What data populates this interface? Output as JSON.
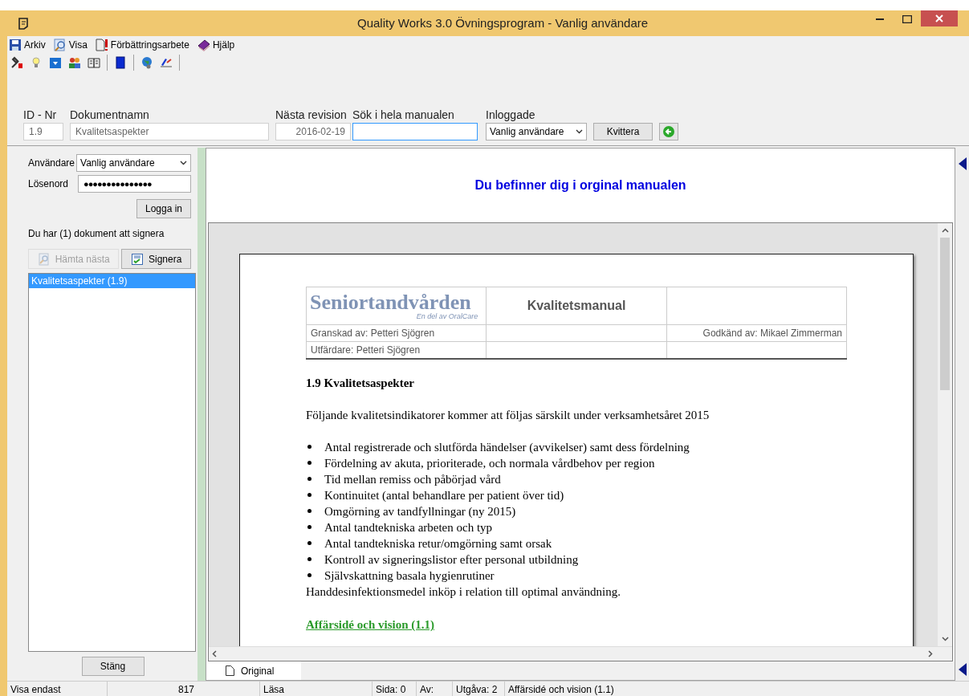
{
  "window": {
    "title": "Quality Works 3.0 Övningsprogram - Vanlig användare"
  },
  "menu": [
    {
      "label": "Arkiv",
      "kind": "save"
    },
    {
      "label": "Visa",
      "kind": "view"
    },
    {
      "label": "Förbättringsarbete",
      "kind": "alert"
    },
    {
      "label": "Hjälp",
      "kind": "help"
    }
  ],
  "toolbar": [
    {
      "kind": "tools"
    },
    {
      "kind": "bulb"
    },
    {
      "kind": "blue"
    },
    {
      "kind": "people"
    },
    {
      "kind": "book"
    },
    {
      "kind": "sep"
    },
    {
      "kind": "binder"
    },
    {
      "kind": "sep"
    },
    {
      "kind": "globe"
    },
    {
      "kind": "sign"
    },
    {
      "kind": "sep"
    }
  ],
  "header_fields": {
    "id_label": "ID - Nr",
    "id_value": "1.9",
    "name_label": "Dokumentnamn",
    "name_value": "Kvalitetsaspekter",
    "revision_label": "Nästa revision",
    "revision_value": "2016-02-19",
    "search_label": "Sök i hela manualen",
    "logged_label": "Inloggade",
    "logged_value": "Vanlig användare",
    "confirm_button": "Kvittera"
  },
  "login": {
    "user_label": "Användare",
    "user_value": "Vanlig användare",
    "password_label": "Lösenord",
    "password_value": "●●●●●●●●●●●●●●●",
    "login_button": "Logga in",
    "message": "Du har (1) dokument att signera",
    "fetch_button": {
      "label": "Hämta nästa",
      "disabled": true
    },
    "sign_button": {
      "label": "Signera",
      "disabled": false
    },
    "documents": [
      {
        "label": "Kvalitetsaspekter (1.9)",
        "selected": true
      }
    ],
    "close_button": "Stäng"
  },
  "content": {
    "banner": "Du befinner dig i orginal manualen",
    "document": {
      "logo": "Seniortandvården",
      "logo_sub": "En del av OralCare",
      "manual_title": "Kvalitetsmanual",
      "reviewed": "Granskad av: Petteri Sjögren",
      "approved": "Godkänd av: Mikael Zimmerman",
      "issuer": "Utfärdare: Petteri Sjögren",
      "heading": "1.9 Kvalitetsaspekter",
      "intro": "Följande kvalitetsindikatorer kommer att följas särskilt under verksamhetsåret 2015",
      "bullets": [
        "Antal registrerade och slutförda händelser (avvikelser) samt dess fördelning",
        "Fördelning av akuta, prioriterade, och normala vårdbehov per region",
        "Tid mellan remiss och påbörjad vård",
        "Kontinuitet (antal behandlare per patient över tid)",
        "Omgörning av tandfyllningar (ny 2015)",
        "Antal tandtekniska arbeten och typ",
        "Antal tandtekniska retur/omgörning samt orsak",
        "Kontroll av signeringslistor efter personal utbildning",
        "Självskattning basala hygienrutiner"
      ],
      "after": "Handdesinfektionsmedel inköp i relation till optimal användning.",
      "link": "Affärsidé och vision (1.1)"
    },
    "tabs": [
      {
        "label": "Original",
        "selected": true
      }
    ]
  },
  "status_bar": [
    "Visa endast",
    "817",
    "Läsa",
    "Sida: 0",
    "Av:",
    "Utgåva: 2",
    "Affärsidé och vision (1.1)"
  ]
}
